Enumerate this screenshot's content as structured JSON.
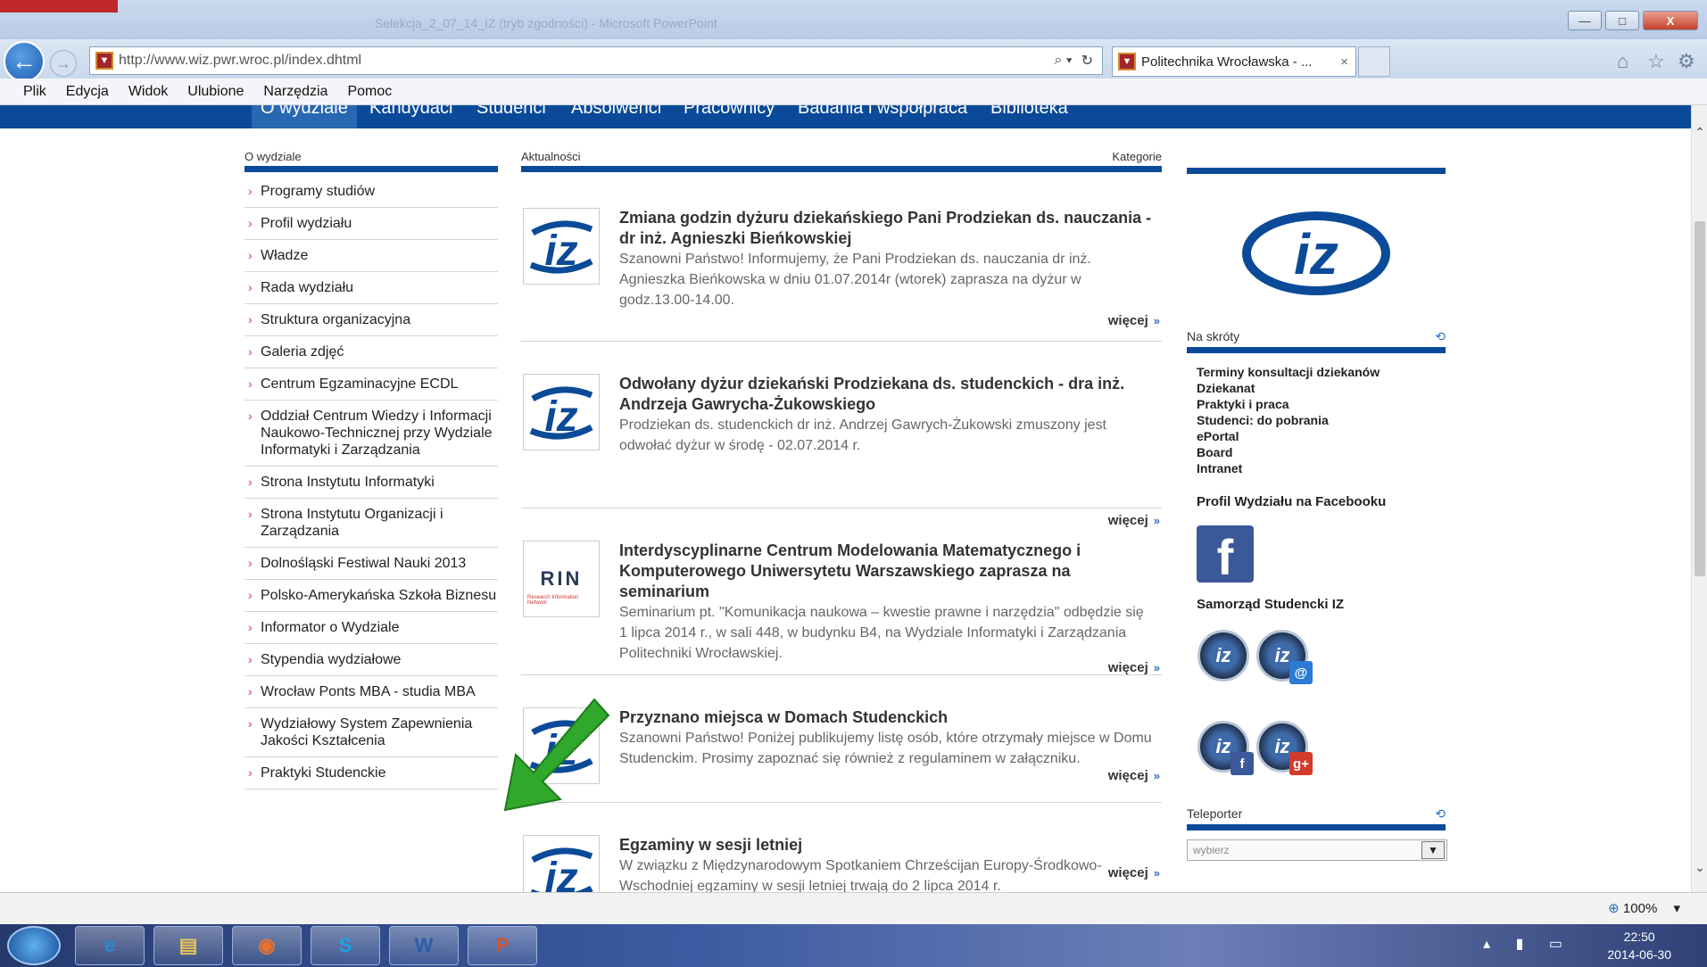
{
  "browser": {
    "url": "http://www.wiz.pwr.wroc.pl/index.dhtml",
    "tab_title": "Politechnika Wrocławska - ...",
    "tab_close": "×",
    "ghost_title": "Selekcja_2_07_14_IZ (tryb zgodności) - Microsoft PowerPoint",
    "window_buttons": [
      "—",
      "□",
      "X"
    ],
    "icons": [
      "back-arrow-icon",
      "forward-arrow-icon",
      "search-icon",
      "refresh-icon",
      "home-icon",
      "favorites-star-icon",
      "settings-gear-icon"
    ]
  },
  "menu": [
    "Plik",
    "Edycja",
    "Widok",
    "Ulubione",
    "Narzędzia",
    "Pomoc"
  ],
  "site_nav": [
    "O wydziale",
    "Kandydaci",
    "Studenci",
    "Absolwenci",
    "Pracownicy",
    "Badania i współpraca",
    "Biblioteka"
  ],
  "left": {
    "heading": "O wydziale",
    "links": [
      "Programy studiów",
      "Profil wydziału",
      "Władze",
      "Rada wydziału",
      "Struktura organizacyjna",
      "Galeria zdjęć",
      "Centrum Egzaminacyjne ECDL",
      "Oddział Centrum Wiedzy i Informacji Naukowo-Technicznej przy Wydziale Informatyki i Zarządzania",
      "Strona Instytutu Informatyki",
      "Strona Instytutu Organizacji i Zarządzania",
      "Dolnośląski Festiwal Nauki 2013",
      "Polsko-Amerykańska Szkoła Biznesu",
      "Informator o Wydziale",
      "Stypendia wydziałowe",
      "Wrocław Ponts MBA - studia MBA",
      "Wydziałowy System Zapewnienia Jakości Kształcenia",
      "Praktyki Studenckie"
    ]
  },
  "middle": {
    "heading": "Aktualności",
    "categories": "Kategorie",
    "more": "więcej",
    "news": [
      {
        "title": "Zmiana godzin dyżuru dziekańskiego Pani Prodziekan ds. nauczania - dr inż. Agnieszki Bieńkowskiej",
        "body": "Szanowni Państwo! Informujemy, że Pani Prodziekan ds. nauczania dr inż. Agnieszka Bieńkowska w dniu 01.07.2014r (wtorek) zaprasza na dyżur w godz.13.00-14.00.",
        "thumb": "iz"
      },
      {
        "title": "Odwołany dyżur dziekański Prodziekana ds. studenckich - dra inż. Andrzeja Gawrycha-Żukowskiego",
        "body": "Prodziekan ds. studenckich dr inż. Andrzej Gawrych-Żukowski zmuszony jest odwołać dyżur w środę - 02.07.2014 r.",
        "thumb": "iz"
      },
      {
        "title": "Interdyscyplinarne Centrum Modelowania Matematycznego i Komputerowego Uniwersytetu Warszawskiego zaprasza na seminarium",
        "body": "Seminarium pt. \"Komunikacja naukowa – kwestie prawne i narzędzia\" odbędzie się 1 lipca 2014 r., w sali 448, w budynku B4, na Wydziale Informatyki i Zarządzania Politechniki Wrocławskiej.",
        "thumb": "rin",
        "thumb_text": "RIN",
        "thumb_sub": "Research Information Network"
      },
      {
        "title": "Przyznano miejsca w Domach Studenckich",
        "body": "Szanowni Państwo! Poniżej publikujemy listę osób, które otrzymały miejsce w Domu Studenckim. Prosimy zapoznać się również z regulaminem w załączniku.",
        "thumb": "iz"
      },
      {
        "title": "Egzaminy w sesji letniej",
        "body": "W związku z Międzynarodowym Spotkaniem Chrześcijan Europy-Środkowo-Wschodniej egzaminy w sesji letniej trwają do 2 lipca 2014 r.",
        "thumb": "iz"
      }
    ]
  },
  "right": {
    "logo_text": "iz",
    "shortcuts_heading": "Na skróty",
    "shortcuts": [
      "Terminy konsultacji dziekanów",
      "Dziekanat",
      "Praktyki i praca",
      "Studenci: do pobrania",
      "ePortal",
      "Board",
      "Intranet"
    ],
    "facebook_label": "Profil Wydziału na Facebooku",
    "facebook_glyph": "f",
    "samorzad_label": "Samorząd Studencki IZ",
    "samorzad_icons": [
      {
        "name": "samorzad-iz-icon",
        "text": "iz",
        "badge": "",
        "badge_color": ""
      },
      {
        "name": "samorzad-email-icon",
        "text": "iz",
        "badge": "@",
        "badge_color": "#2a7ad6"
      },
      {
        "name": "samorzad-facebook-icon",
        "text": "iz",
        "badge": "f",
        "badge_color": "#3b5998"
      },
      {
        "name": "samorzad-googleplus-icon",
        "text": "iz",
        "badge": "g+",
        "badge_color": "#d23b2a"
      }
    ],
    "teleporter_heading": "Teleporter",
    "teleporter_placeholder": "wybierz"
  },
  "status": {
    "zoom": "100%"
  },
  "taskbar": {
    "apps": [
      {
        "name": "internet-explorer-icon",
        "glyph": "e",
        "color": "#2a8ad8"
      },
      {
        "name": "file-explorer-icon",
        "glyph": "▤",
        "color": "#e7c35a"
      },
      {
        "name": "firefox-icon",
        "glyph": "◉",
        "color": "#e8732c"
      },
      {
        "name": "skype-icon",
        "glyph": "S",
        "color": "#1ea0e6"
      },
      {
        "name": "word-icon",
        "glyph": "W",
        "color": "#2a5da8"
      },
      {
        "name": "powerpoint-icon",
        "glyph": "P",
        "color": "#d2542c"
      }
    ],
    "time": "22:50",
    "date": "2014-06-30"
  },
  "colors": {
    "brand_navy": "#0b4a98",
    "link_arrow": "#dd3333",
    "annotation_arrow": "#2fa82b"
  }
}
